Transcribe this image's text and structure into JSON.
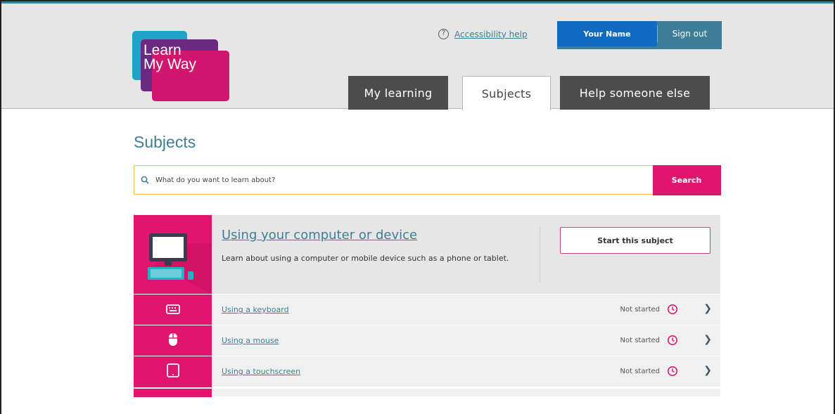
{
  "brand": {
    "logo_line1": "Learn",
    "logo_line2": "My Way"
  },
  "header": {
    "accessibility_help": "Accessibility help",
    "user_name": "Your Name",
    "sign_out": "Sign out"
  },
  "tabs": [
    {
      "label": "My learning",
      "active": false
    },
    {
      "label": "Subjects",
      "active": true
    },
    {
      "label": "Help someone else",
      "active": false
    }
  ],
  "page_title": "Subjects",
  "search": {
    "placeholder": "What do you want to learn about?",
    "button": "Search"
  },
  "subject": {
    "title": "Using your computer or device",
    "description": "Learn about using a computer or mobile device such as a phone or tablet.",
    "start_button": "Start this subject"
  },
  "topics": [
    {
      "label": "Using a keyboard",
      "status": "Not started",
      "icon": "keyboard-icon"
    },
    {
      "label": "Using a mouse",
      "status": "Not started",
      "icon": "mouse-icon"
    },
    {
      "label": "Using a touchscreen",
      "status": "Not started",
      "icon": "tablet-icon"
    }
  ],
  "colors": {
    "brand_pink": "#e0166e",
    "teal": "#3e7d95",
    "header_blue": "#0e6bbf"
  }
}
